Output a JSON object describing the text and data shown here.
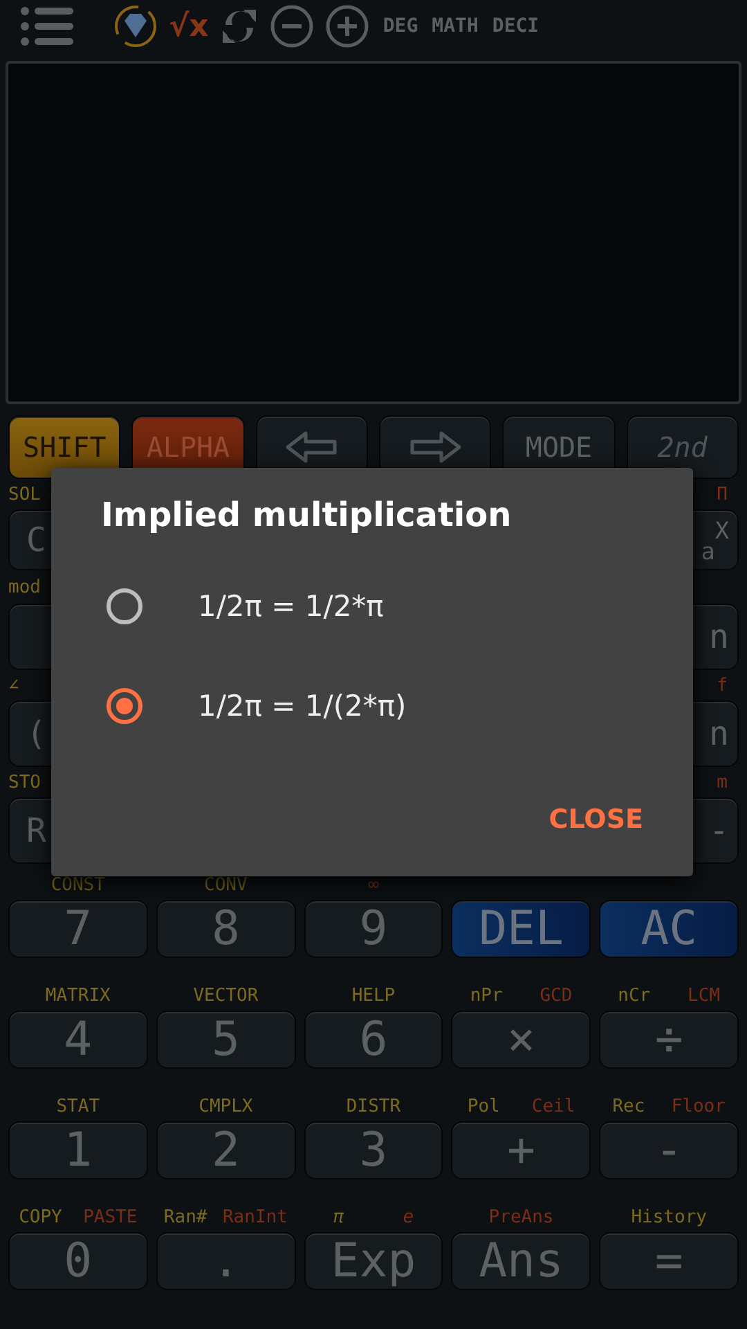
{
  "toolbar": {
    "formula_icon": "√x",
    "status": [
      "DEG",
      "MATH",
      "DECI"
    ]
  },
  "top_keys": [
    {
      "kind": "shift",
      "label": "SHIFT"
    },
    {
      "kind": "alpha",
      "label": "ALPHA"
    },
    {
      "kind": "back"
    },
    {
      "kind": "forward"
    },
    {
      "kind": "plain",
      "label": "MODE"
    },
    {
      "kind": "italic",
      "label": "2nd"
    }
  ],
  "side_rows": [
    {
      "left": {
        "shift": "SOL",
        "label": "C"
      },
      "right": {
        "alpha": "Π",
        "label": "$_{a}$$^{X}$"
      }
    },
    {
      "left": {
        "shift": "mod"
      },
      "right": {
        "label": "n"
      }
    },
    {
      "left": {
        "shift": "∠",
        "label": "("
      },
      "right": {
        "alpha": "f",
        "label": "n"
      }
    },
    {
      "left": {
        "shift": "STO",
        "label": "R"
      },
      "right": {
        "alpha": "m",
        "label": "-"
      }
    }
  ],
  "number_rows": [
    [
      {
        "label": "7",
        "kind": "plain",
        "shift": "CONST"
      },
      {
        "label": "8",
        "kind": "plain",
        "shift": "CONV"
      },
      {
        "label": "9",
        "kind": "plain",
        "alpha": "∞"
      },
      {
        "label": "DEL",
        "kind": "blue"
      },
      {
        "label": "AC",
        "kind": "blue"
      }
    ],
    [
      {
        "label": "4",
        "kind": "plain",
        "shift": "MATRIX"
      },
      {
        "label": "5",
        "kind": "plain",
        "shift": "VECTOR"
      },
      {
        "label": "6",
        "kind": "plain",
        "shift": "HELP"
      },
      {
        "label": "×",
        "kind": "plain",
        "shift": "nPr",
        "alpha": "GCD"
      },
      {
        "label": "÷",
        "kind": "plain",
        "shift": "nCr",
        "alpha": "LCM"
      }
    ],
    [
      {
        "label": "1",
        "kind": "plain",
        "shift": "STAT"
      },
      {
        "label": "2",
        "kind": "plain",
        "shift": "CMPLX"
      },
      {
        "label": "3",
        "kind": "plain",
        "shift": "DISTR"
      },
      {
        "label": "+",
        "kind": "plain",
        "shift": "Pol",
        "alpha": "Ceil"
      },
      {
        "label": "-",
        "kind": "plain",
        "shift": "Rec",
        "alpha": "Floor"
      }
    ],
    [
      {
        "label": "0",
        "kind": "plain",
        "shift": "COPY",
        "alpha": "PASTE"
      },
      {
        "label": ".",
        "kind": "plain",
        "shift": "Ran#",
        "alpha": "RanInt"
      },
      {
        "label": "Exp",
        "kind": "plain",
        "shift": "π",
        "alpha": "e",
        "italic": true
      },
      {
        "label": "Ans",
        "kind": "plain",
        "alpha": "PreAns"
      },
      {
        "label": "=",
        "kind": "plain",
        "shift": "History"
      }
    ]
  ],
  "dialog": {
    "title": "Implied multiplication",
    "options": [
      {
        "label": "1/2π = 1/2*π",
        "selected": false
      },
      {
        "label": "1/2π = 1/(2*π)",
        "selected": true
      }
    ],
    "close": "CLOSE"
  }
}
